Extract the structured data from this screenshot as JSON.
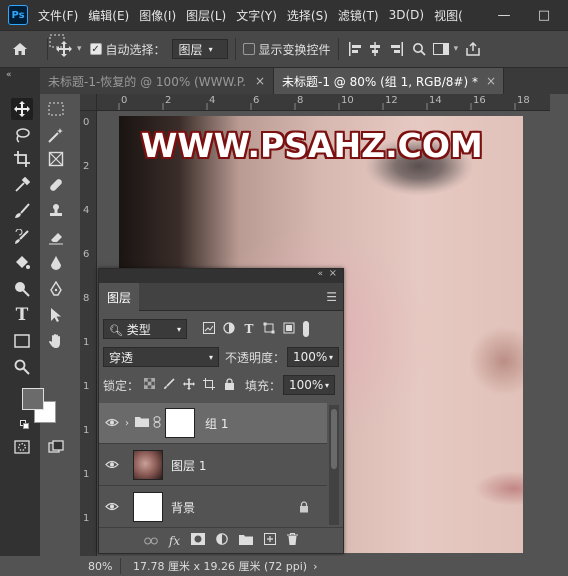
{
  "menubar": {
    "logo": "Ps",
    "items": [
      "文件(F)",
      "编辑(E)",
      "图像(I)",
      "图层(L)",
      "文字(Y)",
      "选择(S)",
      "滤镜(T)",
      "3D(D)",
      "视图("
    ],
    "window_buttons": [
      "—",
      "□"
    ]
  },
  "options": {
    "auto_select_label": "自动选择：",
    "auto_select_checked": true,
    "target_value": "图层",
    "show_transform_label": "显示变换控件",
    "show_transform_checked": false
  },
  "tabs": [
    {
      "label": "未标题-1-恢复的 @ 100% (WWW.P...",
      "close": "×",
      "active": false
    },
    {
      "label": "未标题-1 @ 80% (组 1, RGB/8#) *",
      "close": "×",
      "active": true
    }
  ],
  "ruler": {
    "h_ticks": [
      "0",
      "2",
      "4",
      "6",
      "8",
      "10",
      "12",
      "14",
      "16",
      "18"
    ],
    "v_ticks": [
      "0",
      "2",
      "4",
      "6",
      "8",
      "1",
      "1",
      "1",
      "1",
      "1"
    ]
  },
  "canvas": {
    "watermark": "WWW.PSAHZ.COM"
  },
  "layers_panel": {
    "title": "图层",
    "filter_type": "类型",
    "blend_mode": "穿透",
    "opacity_label": "不透明度：",
    "opacity_value": "100%",
    "lock_label": "锁定：",
    "fill_label": "填充：",
    "fill_value": "100%",
    "layers": [
      {
        "name": "组 1",
        "kind": "group",
        "selected": true
      },
      {
        "name": "图层 1",
        "kind": "photo",
        "selected": false
      },
      {
        "name": "背景",
        "kind": "background",
        "selected": false
      }
    ],
    "footer_icons": [
      "link-icon",
      "fx-icon",
      "mask-icon",
      "adjustment-icon",
      "folder-icon",
      "new-layer-icon",
      "trash-icon"
    ]
  },
  "status": {
    "zoom": "80%",
    "doc_info": "17.78 厘米 x 19.26 厘米 (72 ppi)",
    "arrow": "›"
  }
}
